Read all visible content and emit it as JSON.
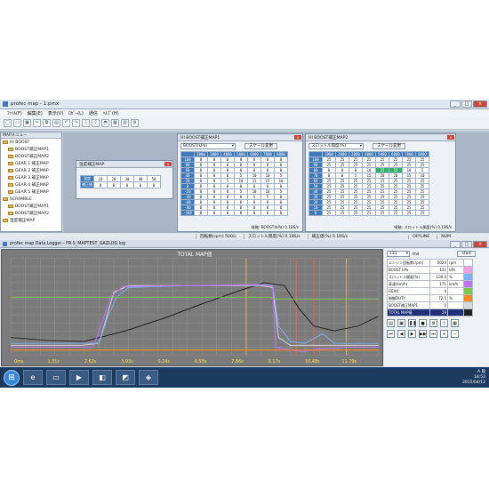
{
  "app": {
    "title": "profec map - 1.pmx",
    "window_buttons": [
      "_",
      "□",
      "×"
    ]
  },
  "menu": [
    "ﾌｧｲﾙ(F)",
    "編集(E)",
    "表示(V)",
    "ﾛｶﾞｰ(L)",
    "通信",
    "ﾍﾙﾌﾟ(H)"
  ],
  "toolbar_icons": [
    "new-icon",
    "open-icon",
    "save-icon",
    "cut-icon",
    "copy-icon",
    "paste-icon",
    "undo-icon",
    "redo-icon",
    "read-icon",
    "write-icon",
    "car-icon",
    "logger-icon",
    "graph-icon",
    "settings-icon"
  ],
  "tree": {
    "header": "MAPメニュー",
    "items": [
      "HI BOOST",
      "BOOST補正MAP1",
      "BOOST補正MAP2",
      "GEAR 1 補正MAP",
      "GEAR 2 補正MAP",
      "GEAR 3 補正MAP",
      "GEAR 4 補正MAP",
      "GEAR 5 補正MAP",
      "SCRAMBLE",
      "BOOST補正MAP1",
      "BOOST補正MAP2",
      "温度補正MAP"
    ]
  },
  "temp_win": {
    "title": "温度補正MAP",
    "rows": [
      [
        "温度",
        "10",
        "20",
        "30",
        "40",
        "50"
      ],
      [
        "補正値",
        "0",
        "0",
        "0",
        "0",
        "0"
      ]
    ]
  },
  "map1": {
    "title": "HI BOOST補正MAP1",
    "select": "BOOST(kPa)",
    "button": "スケール変更",
    "header": [
      "",
      "2000",
      "3000",
      "4000",
      "5000",
      "6000",
      "7000",
      "8000"
    ],
    "rows": [
      [
        "100",
        "0",
        "0",
        "0",
        "0",
        "0",
        "0",
        "0"
      ],
      [
        "80",
        "0",
        "0",
        "0",
        "0",
        "0",
        "0",
        "0"
      ],
      [
        "60",
        "0",
        "0",
        "0",
        "0",
        "0",
        "0",
        "0"
      ],
      [
        "40",
        "0",
        "0",
        "0",
        "5",
        "10",
        "10",
        "5"
      ],
      [
        "20",
        "0",
        "0",
        "5",
        "10",
        "15",
        "15",
        "10"
      ],
      [
        "0",
        "0",
        "0",
        "0",
        "0",
        "0",
        "0",
        "0"
      ],
      [
        "-20",
        "0",
        "0",
        "0",
        "5",
        "10",
        "10",
        "5"
      ],
      [
        "-40",
        "0",
        "0",
        "0",
        "0",
        "5",
        "5",
        "0"
      ],
      [
        "-60",
        "0",
        "0",
        "0",
        "0",
        "0",
        "0",
        "0"
      ],
      [
        "-80",
        "0",
        "0",
        "0",
        "0",
        "0",
        "0",
        "0"
      ],
      [
        "-100",
        "0",
        "0",
        "0",
        "0",
        "0",
        "0",
        "0"
      ]
    ],
    "footer": "縦軸: BOOST(kPa)  0.1BS/s"
  },
  "map2": {
    "title": "HI BOOST補正MAP2",
    "select": "スロットル開度(%)",
    "button": "スケール変更",
    "header": [
      "",
      "1000",
      "2000",
      "3000",
      "4000",
      "5000",
      "6000",
      "7000",
      "8000"
    ],
    "rows": [
      [
        "100",
        "25",
        "25",
        "25",
        "25",
        "25",
        "25",
        "25",
        "25"
      ],
      [
        "90",
        "25",
        "25",
        "25",
        "25",
        "25",
        "25",
        "25",
        "25"
      ],
      [
        "80",
        "0",
        "0",
        "0",
        "10",
        "15",
        "15",
        "10",
        "5"
      ],
      [
        "70",
        "0",
        "0",
        "5",
        "15",
        "20",
        "20",
        "15",
        "10"
      ],
      [
        "60",
        "25",
        "25",
        "25",
        "25",
        "25",
        "25",
        "25",
        "25"
      ],
      [
        "50",
        "25",
        "25",
        "25",
        "25",
        "25",
        "25",
        "25",
        "25"
      ],
      [
        "40",
        "25",
        "25",
        "25",
        "25",
        "25",
        "25",
        "25",
        "25"
      ],
      [
        "30",
        "25",
        "25",
        "25",
        "25",
        "25",
        "25",
        "25",
        "25"
      ],
      [
        "20",
        "25",
        "25",
        "25",
        "25",
        "25",
        "25",
        "25",
        "25"
      ],
      [
        "10",
        "25",
        "25",
        "25",
        "25",
        "25",
        "25",
        "25",
        "25"
      ],
      [
        "0",
        "25",
        "25",
        "25",
        "25",
        "25",
        "25",
        "25",
        "25"
      ]
    ],
    "footer": "縦軸: スロットル開度(%)  0.1BS/s"
  },
  "status": {
    "text1": "回転数(rpm)  500/s",
    "text2": "スロットル開度(%)  0.1BS/s",
    "text3": "補正値(%)  0.1BS/s",
    "offline": "OFFLINE",
    "num": "NUM"
  },
  "logger": {
    "title": "profec map Data Logger - FR-S_MAPTEST_GAZLOG.log",
    "chart_title": "TOTAL MAP値",
    "time_select": "131",
    "unit": "ms",
    "start_button": "start",
    "params": [
      [
        "エンジン回転数(rpm)",
        "6024",
        "rpm"
      ],
      [
        "BOOST kPa",
        "131",
        "kPa"
      ],
      [
        "スロットル開度(%)",
        "100.0",
        "%"
      ],
      [
        "車速(km/h)",
        "171",
        "km/h"
      ],
      [
        "GEAR",
        "4",
        ""
      ],
      [
        "制御DUTY",
        "72.5",
        "%"
      ],
      [
        "BOOST補正MAP1",
        "0",
        ""
      ],
      [
        "TOTAL MAP値",
        "29",
        ""
      ]
    ]
  },
  "taskbar": {
    "time": "18:53",
    "date": "2015/04/12",
    "ime": "A 般"
  },
  "chart_data": {
    "type": "line",
    "title": "TOTAL MAP値",
    "x_ticks": [
      "0ms",
      "1.31s",
      "2.62s",
      "3.93s",
      "5.24s",
      "6.55s",
      "7.86s",
      "9.17s",
      "10.48s",
      "11.79s"
    ],
    "xlim": [
      0,
      12.5
    ],
    "ylim": [
      0,
      100
    ],
    "series": [
      {
        "color": "#202020",
        "x": [
          0,
          1.3,
          2.5,
          3.9,
          5.2,
          6.5,
          7.8,
          8.6,
          9.3,
          9.8,
          10.3,
          11.0,
          11.8,
          12.5
        ],
        "y": [
          18,
          15,
          14,
          25,
          38,
          53,
          67,
          75,
          72,
          48,
          30,
          25,
          30,
          40
        ]
      },
      {
        "color": "#d8d8d8",
        "x": [
          0,
          1.4,
          2.4,
          3.0,
          3.5,
          4.0,
          6.5,
          8.5,
          8.9,
          9.1,
          9.5,
          10.0,
          11.0,
          12.5
        ],
        "y": [
          10,
          10,
          10,
          12,
          65,
          72,
          72,
          72,
          70,
          18,
          10,
          10,
          10,
          10
        ]
      },
      {
        "color": "#7db0ff",
        "x": [
          0,
          3.0,
          3.3,
          3.6,
          4.0,
          6.0,
          8.5,
          8.9,
          9.1,
          9.5,
          10.0,
          10.6,
          11.0,
          12.5
        ],
        "y": [
          12,
          12,
          40,
          60,
          70,
          72,
          73,
          72,
          30,
          14,
          12,
          22,
          12,
          12
        ]
      },
      {
        "color": "#c070ff",
        "x": [
          0,
          2.8,
          3.4,
          3.8,
          6.0,
          8.5,
          8.9,
          9.0,
          9.4,
          9.9,
          10.4,
          11.5,
          12.5
        ],
        "y": [
          8,
          8,
          60,
          71,
          72,
          73,
          71,
          8,
          6,
          3,
          6,
          8,
          8
        ]
      },
      {
        "color": "#ff8c1a",
        "x": [
          0,
          3.5,
          3.6,
          6.0,
          8.8,
          8.9,
          9.0,
          12.5
        ],
        "y": [
          5,
          5,
          5,
          5,
          5,
          5,
          5,
          5
        ]
      },
      {
        "color": "#7cc94e",
        "x": [
          0,
          4.0,
          8.8,
          9.0,
          12.5
        ],
        "y": [
          60,
          60,
          60,
          58,
          58
        ]
      }
    ],
    "markers": [
      {
        "x": 8.0,
        "color": "#f3c24a"
      },
      {
        "x": 9.7,
        "color": "#ff5b5b"
      },
      {
        "x": 10.3,
        "color": "#ff5b5b"
      },
      {
        "x": 11.4,
        "color": "#f3c24a"
      }
    ],
    "grid": true
  }
}
